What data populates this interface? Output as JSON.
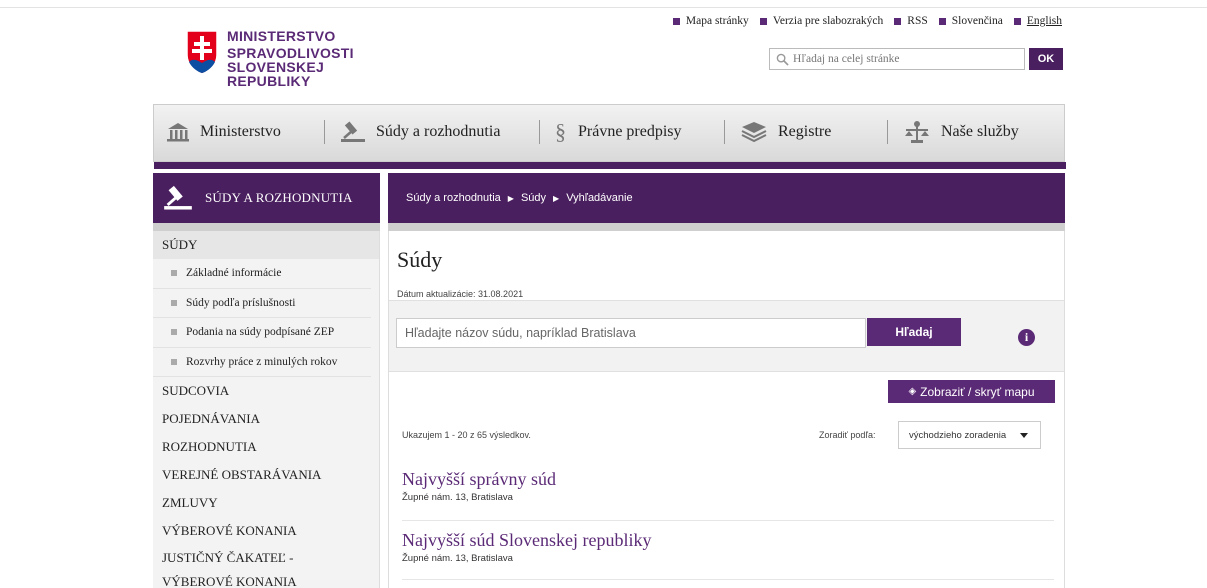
{
  "header": {
    "logo": {
      "line1": "MINISTERSTVO",
      "line2": "SPRAVODLIVOSTI",
      "line3": "SLOVENSKEJ REPUBLIKY"
    },
    "top_links": [
      "Mapa stránky",
      "Verzia pre slabozrakých",
      "RSS",
      "Slovenčina",
      "English"
    ],
    "search": {
      "placeholder": "Hľadaj na celej stránke",
      "button": "OK"
    }
  },
  "main_nav": [
    "Ministerstvo",
    "Súdy a rozhodnutia",
    "Právne predpisy",
    "Registre",
    "Naše služby"
  ],
  "sidebar": {
    "title": "SÚDY A ROZHODNUTIA",
    "active": "SÚDY",
    "sub_items": [
      "Základné informácie",
      "Súdy podľa príslušnosti",
      "Podania na súdy podpísané ZEP",
      "Rozvrhy práce z minulých rokov"
    ],
    "items": [
      "SUDCOVIA",
      "POJEDNÁVANIA",
      "ROZHODNUTIA",
      "VEREJNÉ OBSTARÁVANIA",
      "ZMLUVY",
      "VÝBEROVÉ KONANIA",
      "JUSTIČNÝ ČAKATEĽ -",
      "VÝBEROVÉ KONANIA"
    ]
  },
  "breadcrumb": [
    "Súdy a rozhodnutia",
    "Súdy",
    "Vyhľadávanie"
  ],
  "content": {
    "title": "Súdy",
    "updated": "Dátum aktualizácie: 31.08.2021",
    "search_placeholder": "Hľadajte názov súdu, napríklad Bratislava",
    "search_button": "Hľadaj",
    "map_toggle": "Zobraziť / skryť mapu",
    "result_count": "Ukazujem 1 - 20 z 65 výsledkov.",
    "sort_label": "Zoradiť podľa:",
    "sort_value": "východzieho zoradenia",
    "results": [
      {
        "name": "Najvyšší správny súd",
        "address": "Župné nám. 13, Bratislava"
      },
      {
        "name": "Najvyšší súd Slovenskej republiky",
        "address": "Župné nám. 13, Bratislava"
      }
    ]
  },
  "colors": {
    "brand": "#5b2a76",
    "brand_dark": "#4a1f5f"
  }
}
